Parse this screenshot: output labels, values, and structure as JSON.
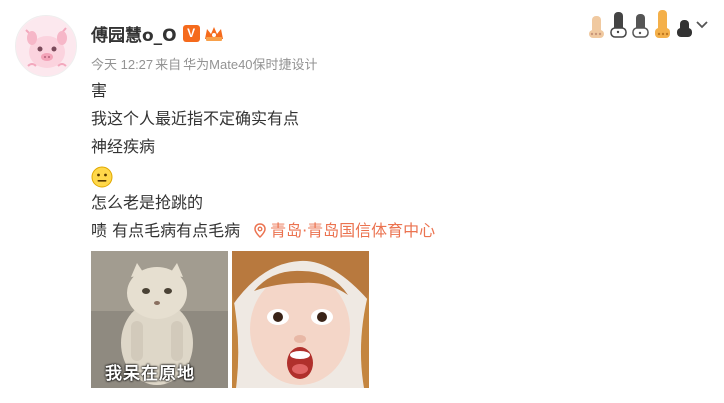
{
  "user": {
    "name": "傅园慧o_O",
    "vip_badge": "V"
  },
  "meta": {
    "time": "今天 12:27",
    "source_prefix": "来自",
    "device": "华为Mate40保时捷设计"
  },
  "content": {
    "lines": [
      "害",
      "我这个人最近指不定确实有点",
      "神经疾病"
    ],
    "emoji": "neutral-face-emoji",
    "line_after_emoji": "怎么老是抢跳的",
    "last_line": "啧 有点毛病有点毛病",
    "location": "青岛·青岛国信体育中心"
  },
  "images": [
    {
      "caption": "我呆在原地",
      "icon": "stunned-cat-meme"
    },
    {
      "icon": "surprised-face-photo"
    }
  ],
  "cat_decoration": {
    "count": 5,
    "icon": "cat-paws-decoration"
  },
  "colors": {
    "text": "#333333",
    "meta": "#939393",
    "location": "#eb7350",
    "vip": "#f56a1c"
  }
}
